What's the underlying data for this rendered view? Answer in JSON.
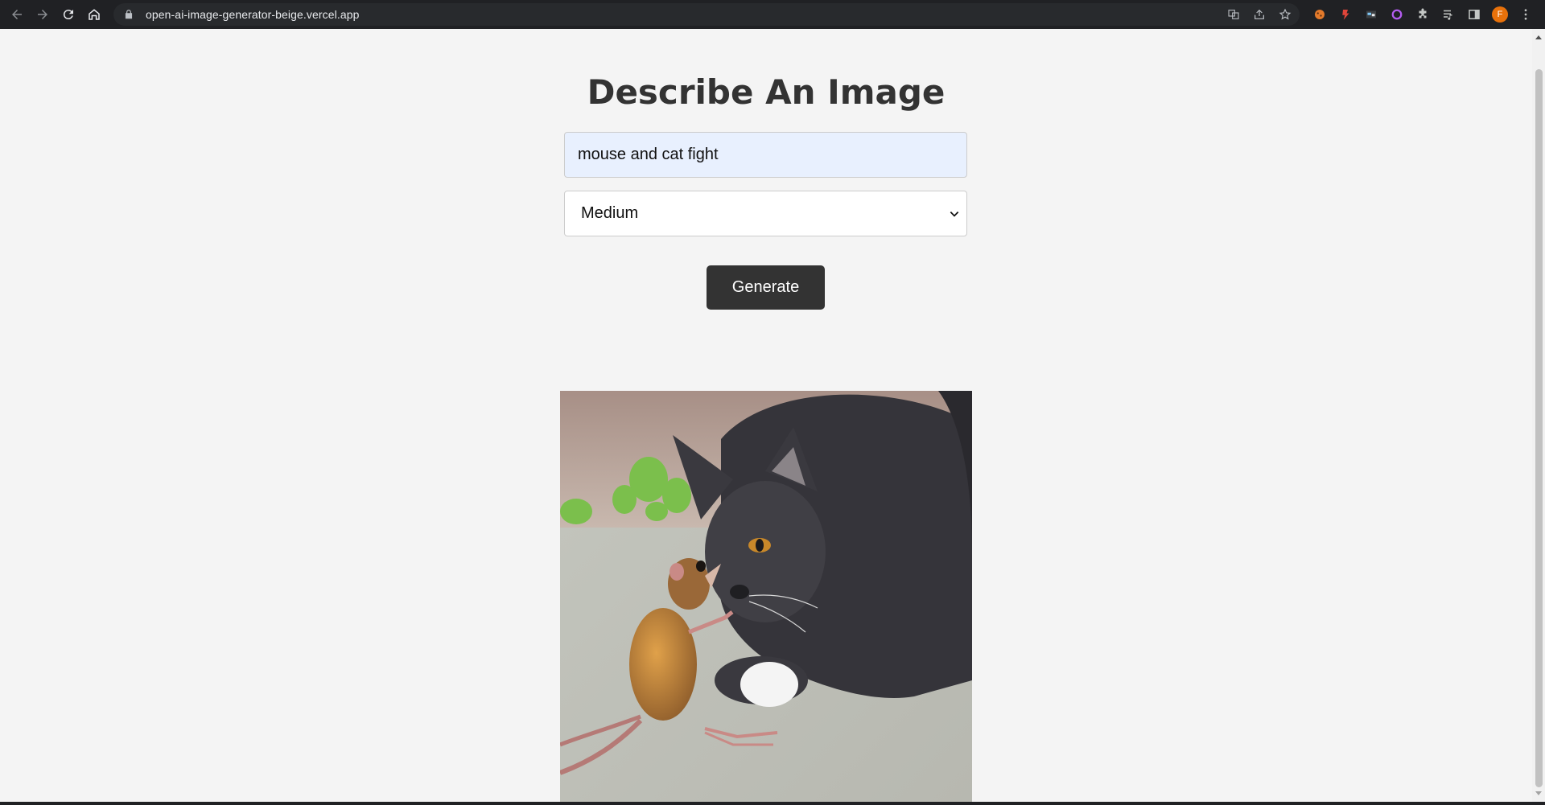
{
  "browser": {
    "url": "open-ai-image-generator-beige.vercel.app",
    "profile_initial": "F",
    "nav_icons": [
      "back-icon",
      "forward-icon",
      "reload-icon",
      "home-icon"
    ],
    "extension_icons": [
      "translate-icon",
      "share-icon",
      "star-icon",
      "cookie-extension-icon",
      "red-extension-icon",
      "window-extension-icon",
      "circle-extension-icon",
      "puzzle-icon",
      "media-queue-icon",
      "side-panel-icon",
      "menu-icon"
    ]
  },
  "page": {
    "title": "Describe An Image",
    "prompt_value": "mouse and cat fight",
    "size_selected": "Medium",
    "generate_label": "Generate",
    "result_image": "generated-image-cat-and-mouse"
  },
  "colors": {
    "page_bg": "#f4f4f4",
    "button_bg": "#333333",
    "input_autofill_bg": "#e8f0fe",
    "avatar": "#e8710a"
  }
}
